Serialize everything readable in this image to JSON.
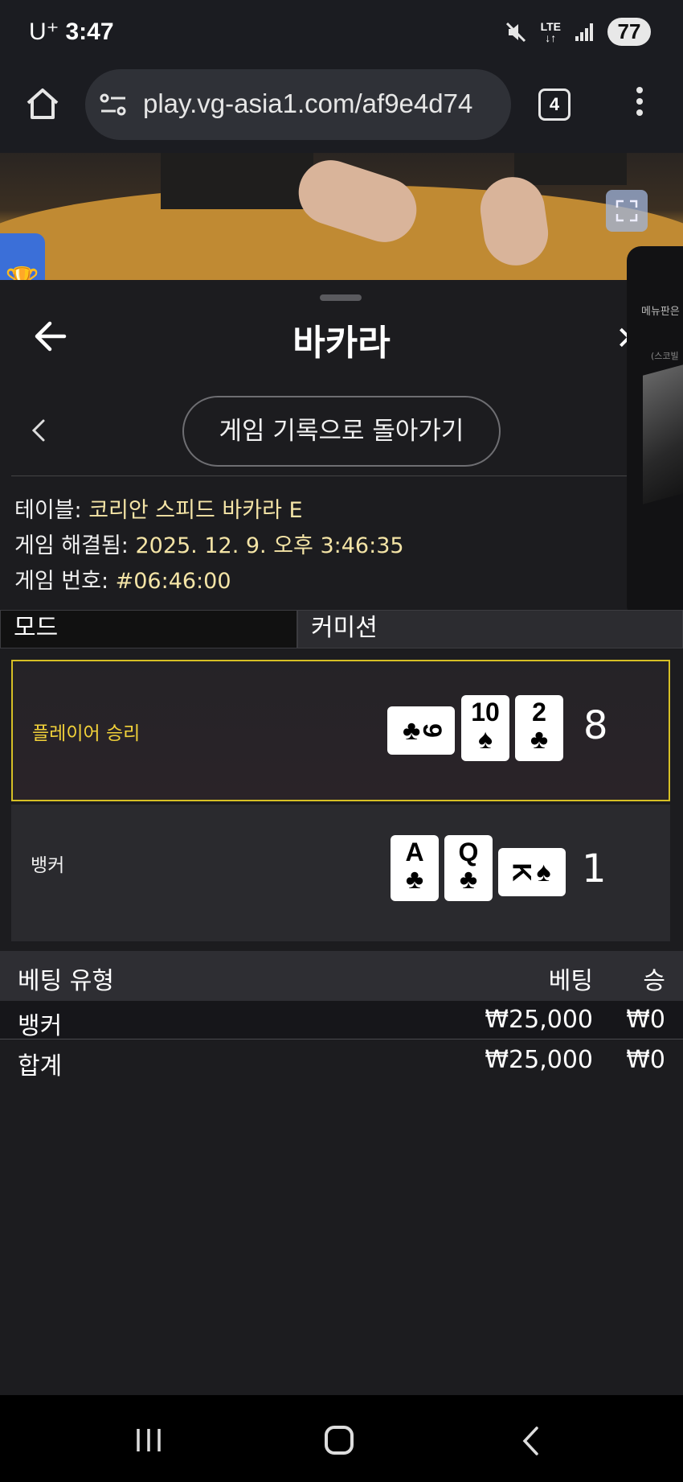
{
  "status_bar": {
    "carrier": "U⁺",
    "time": "3:47",
    "network": "LTE",
    "battery": "77"
  },
  "browser": {
    "url": "play.vg-asia1.com/af9e4d74",
    "tab_count": "4"
  },
  "sheet": {
    "title": "바카라",
    "close_glyph": "✕",
    "return_button": "게임 기록으로 돌아가기"
  },
  "info": {
    "table_label": "테이블: ",
    "table_value": "코리안 스피드 바카라 E",
    "resolved_label": "게임 해결됨: ",
    "resolved_value": "2025. 12. 9. 오후 3:46:35",
    "number_label": "게임 번호: ",
    "number_value": "#06:46:00"
  },
  "mode_row": {
    "mode": "모드",
    "commission": "커미션"
  },
  "results": {
    "player": {
      "label": "플레이어 승리",
      "score": "8",
      "cards": [
        {
          "rank": "9",
          "suit": "♣",
          "orientation": "sideways"
        },
        {
          "rank": "10",
          "suit": "♠",
          "orientation": "upright"
        },
        {
          "rank": "2",
          "suit": "♣",
          "orientation": "upright"
        }
      ]
    },
    "banker": {
      "label": "뱅커",
      "score": "1",
      "cards": [
        {
          "rank": "A",
          "suit": "♣",
          "orientation": "upright"
        },
        {
          "rank": "Q",
          "suit": "♣",
          "orientation": "upright"
        },
        {
          "rank": "K",
          "suit": "♠",
          "orientation": "sideways"
        }
      ]
    }
  },
  "bets": {
    "headers": {
      "type": "베팅 유형",
      "bet": "베팅",
      "win": "승"
    },
    "rows": [
      {
        "type": "뱅커",
        "bet": "₩25,000",
        "win": "₩0"
      },
      {
        "type": "합계",
        "bet": "₩25,000",
        "win": "₩0"
      }
    ]
  },
  "side_panel": {
    "title": "메뉴판은",
    "caption": "(스코빌"
  },
  "colors": {
    "accent_gold": "#d6bf25",
    "player_win_text": "#f2d23a",
    "info_value": "#f4e4a6"
  },
  "icons": {
    "trophy": "🏆"
  }
}
